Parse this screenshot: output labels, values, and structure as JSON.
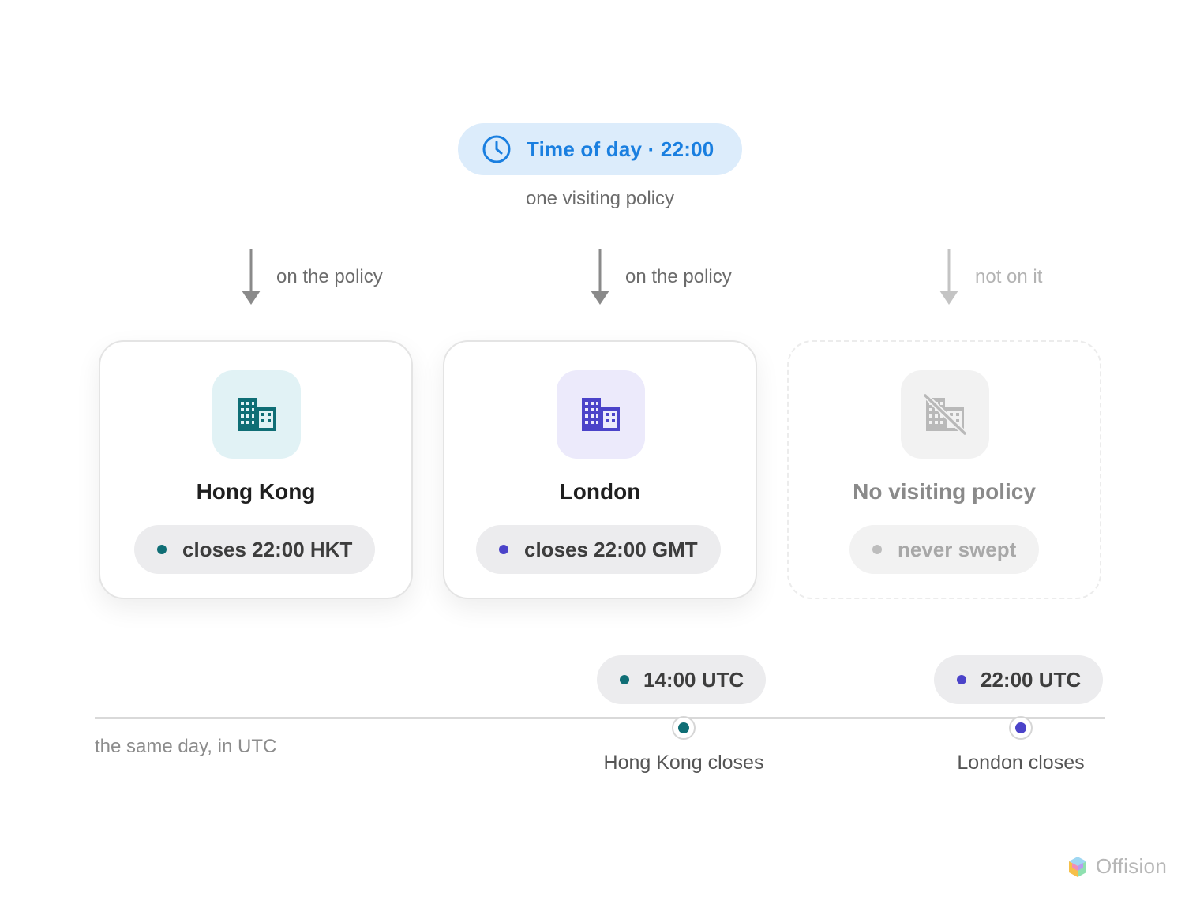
{
  "policy": {
    "icon": "clock-icon",
    "label": "Time of day · 22:00",
    "caption": "one visiting policy",
    "color": "#1a7fe0",
    "background": "#dcecfb"
  },
  "arrows": [
    {
      "label": "on the policy",
      "state": "active"
    },
    {
      "label": "on the policy",
      "state": "active"
    },
    {
      "label": "not on it",
      "state": "muted"
    }
  ],
  "offices": [
    {
      "name": "Hong Kong",
      "icon": "building-icon",
      "status": "closes 22:00 HKT",
      "color": "#0f6e75",
      "tile_color": "#e1f2f5"
    },
    {
      "name": "London",
      "icon": "building-icon",
      "status": "closes 22:00 GMT",
      "color": "#4b43c9",
      "tile_color": "#eceafb"
    },
    {
      "name": "No visiting policy",
      "icon": "building-off-icon",
      "status": "never swept",
      "color": "#a8a8a8",
      "tile_color": "#f2f2f2"
    }
  ],
  "timeline": {
    "caption": "the same day, in UTC",
    "events": [
      {
        "time": "14:00 UTC",
        "label": "Hong Kong closes",
        "color": "#0f6e75"
      },
      {
        "time": "22:00 UTC",
        "label": "London closes",
        "color": "#4b43c9"
      }
    ]
  },
  "brand": {
    "name": "Offision",
    "icon": "offision-logo-icon"
  }
}
